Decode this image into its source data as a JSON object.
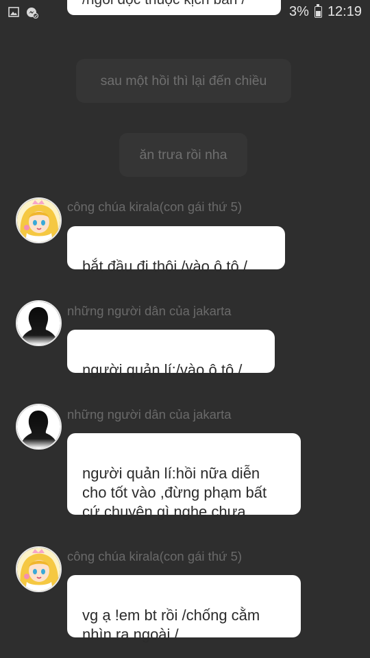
{
  "status_bar": {
    "battery_percent": "3%",
    "time": "12:19",
    "icons": [
      "image-icon",
      "messenger-icon",
      "battery-icon"
    ]
  },
  "top_bubble_partial": "/ngồi đọc thuộc kịch bản /",
  "narrations": [
    "sau một hồi thì lại đến chiều",
    "ăn trưa rồi nha"
  ],
  "messages": [
    {
      "sender": "công chúa kirala(con gái thứ 5)",
      "avatar": "princess-avatar",
      "text": "bắt đầu đi thôi /vào ô tô /"
    },
    {
      "sender": "những người dân của jakarta",
      "avatar": "silhouette-avatar",
      "text": "người quản lí:/vào ô tô /"
    },
    {
      "sender": "những người dân của jakarta",
      "avatar": "silhouette-avatar",
      "text": "người quản lí:hồi nữa diễn\ncho tốt vào ,đừng phạm bất\ncứ chuyện gì nghe chưa"
    },
    {
      "sender": "công chúa kirala(con gái thứ 5)",
      "avatar": "princess-avatar",
      "text": "vg ạ !em bt rồi /chống cằm\nnhìn ra ngoài /"
    }
  ],
  "colors": {
    "background": "#2e2e2e",
    "narration_bg": "#353535",
    "narration_text": "#6f6f6f",
    "sender_text": "#6a6a6a",
    "bubble_bg": "#ffffff"
  }
}
